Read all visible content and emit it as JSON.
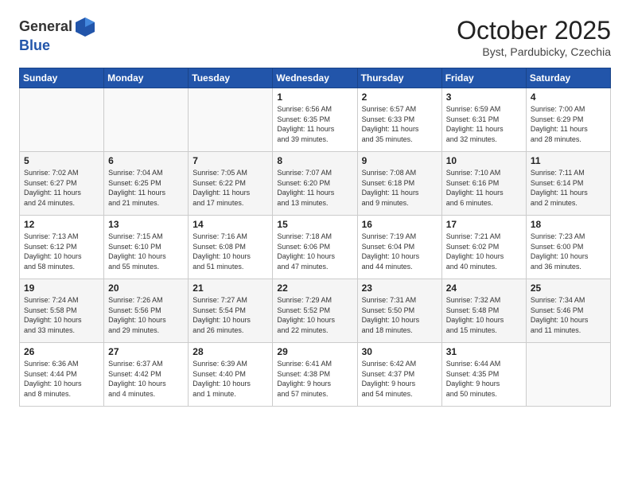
{
  "header": {
    "logo_line1": "General",
    "logo_line2": "Blue",
    "month": "October 2025",
    "location": "Byst, Pardubicky, Czechia"
  },
  "days_of_week": [
    "Sunday",
    "Monday",
    "Tuesday",
    "Wednesday",
    "Thursday",
    "Friday",
    "Saturday"
  ],
  "weeks": [
    [
      {
        "day": "",
        "info": ""
      },
      {
        "day": "",
        "info": ""
      },
      {
        "day": "",
        "info": ""
      },
      {
        "day": "1",
        "info": "Sunrise: 6:56 AM\nSunset: 6:35 PM\nDaylight: 11 hours\nand 39 minutes."
      },
      {
        "day": "2",
        "info": "Sunrise: 6:57 AM\nSunset: 6:33 PM\nDaylight: 11 hours\nand 35 minutes."
      },
      {
        "day": "3",
        "info": "Sunrise: 6:59 AM\nSunset: 6:31 PM\nDaylight: 11 hours\nand 32 minutes."
      },
      {
        "day": "4",
        "info": "Sunrise: 7:00 AM\nSunset: 6:29 PM\nDaylight: 11 hours\nand 28 minutes."
      }
    ],
    [
      {
        "day": "5",
        "info": "Sunrise: 7:02 AM\nSunset: 6:27 PM\nDaylight: 11 hours\nand 24 minutes."
      },
      {
        "day": "6",
        "info": "Sunrise: 7:04 AM\nSunset: 6:25 PM\nDaylight: 11 hours\nand 21 minutes."
      },
      {
        "day": "7",
        "info": "Sunrise: 7:05 AM\nSunset: 6:22 PM\nDaylight: 11 hours\nand 17 minutes."
      },
      {
        "day": "8",
        "info": "Sunrise: 7:07 AM\nSunset: 6:20 PM\nDaylight: 11 hours\nand 13 minutes."
      },
      {
        "day": "9",
        "info": "Sunrise: 7:08 AM\nSunset: 6:18 PM\nDaylight: 11 hours\nand 9 minutes."
      },
      {
        "day": "10",
        "info": "Sunrise: 7:10 AM\nSunset: 6:16 PM\nDaylight: 11 hours\nand 6 minutes."
      },
      {
        "day": "11",
        "info": "Sunrise: 7:11 AM\nSunset: 6:14 PM\nDaylight: 11 hours\nand 2 minutes."
      }
    ],
    [
      {
        "day": "12",
        "info": "Sunrise: 7:13 AM\nSunset: 6:12 PM\nDaylight: 10 hours\nand 58 minutes."
      },
      {
        "day": "13",
        "info": "Sunrise: 7:15 AM\nSunset: 6:10 PM\nDaylight: 10 hours\nand 55 minutes."
      },
      {
        "day": "14",
        "info": "Sunrise: 7:16 AM\nSunset: 6:08 PM\nDaylight: 10 hours\nand 51 minutes."
      },
      {
        "day": "15",
        "info": "Sunrise: 7:18 AM\nSunset: 6:06 PM\nDaylight: 10 hours\nand 47 minutes."
      },
      {
        "day": "16",
        "info": "Sunrise: 7:19 AM\nSunset: 6:04 PM\nDaylight: 10 hours\nand 44 minutes."
      },
      {
        "day": "17",
        "info": "Sunrise: 7:21 AM\nSunset: 6:02 PM\nDaylight: 10 hours\nand 40 minutes."
      },
      {
        "day": "18",
        "info": "Sunrise: 7:23 AM\nSunset: 6:00 PM\nDaylight: 10 hours\nand 36 minutes."
      }
    ],
    [
      {
        "day": "19",
        "info": "Sunrise: 7:24 AM\nSunset: 5:58 PM\nDaylight: 10 hours\nand 33 minutes."
      },
      {
        "day": "20",
        "info": "Sunrise: 7:26 AM\nSunset: 5:56 PM\nDaylight: 10 hours\nand 29 minutes."
      },
      {
        "day": "21",
        "info": "Sunrise: 7:27 AM\nSunset: 5:54 PM\nDaylight: 10 hours\nand 26 minutes."
      },
      {
        "day": "22",
        "info": "Sunrise: 7:29 AM\nSunset: 5:52 PM\nDaylight: 10 hours\nand 22 minutes."
      },
      {
        "day": "23",
        "info": "Sunrise: 7:31 AM\nSunset: 5:50 PM\nDaylight: 10 hours\nand 18 minutes."
      },
      {
        "day": "24",
        "info": "Sunrise: 7:32 AM\nSunset: 5:48 PM\nDaylight: 10 hours\nand 15 minutes."
      },
      {
        "day": "25",
        "info": "Sunrise: 7:34 AM\nSunset: 5:46 PM\nDaylight: 10 hours\nand 11 minutes."
      }
    ],
    [
      {
        "day": "26",
        "info": "Sunrise: 6:36 AM\nSunset: 4:44 PM\nDaylight: 10 hours\nand 8 minutes."
      },
      {
        "day": "27",
        "info": "Sunrise: 6:37 AM\nSunset: 4:42 PM\nDaylight: 10 hours\nand 4 minutes."
      },
      {
        "day": "28",
        "info": "Sunrise: 6:39 AM\nSunset: 4:40 PM\nDaylight: 10 hours\nand 1 minute."
      },
      {
        "day": "29",
        "info": "Sunrise: 6:41 AM\nSunset: 4:38 PM\nDaylight: 9 hours\nand 57 minutes."
      },
      {
        "day": "30",
        "info": "Sunrise: 6:42 AM\nSunset: 4:37 PM\nDaylight: 9 hours\nand 54 minutes."
      },
      {
        "day": "31",
        "info": "Sunrise: 6:44 AM\nSunset: 4:35 PM\nDaylight: 9 hours\nand 50 minutes."
      },
      {
        "day": "",
        "info": ""
      }
    ]
  ]
}
